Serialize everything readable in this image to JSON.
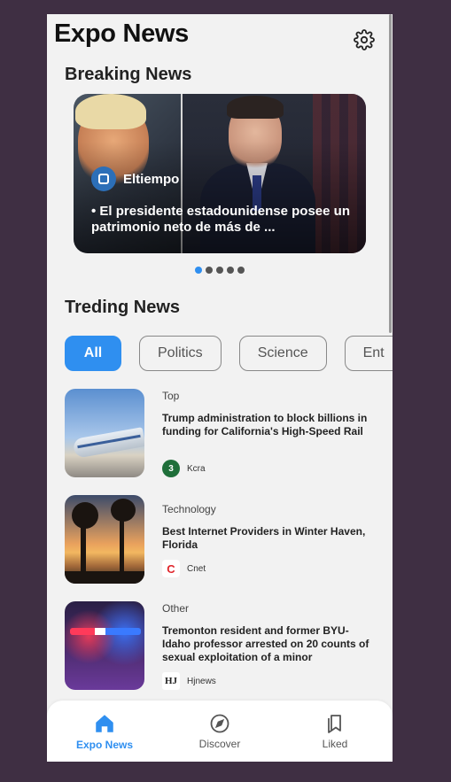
{
  "app": {
    "title": "Expo News"
  },
  "breaking": {
    "section_title": "Breaking News",
    "source": "Eltiempo",
    "headline": "• El presidente estadounidense posee un patrimonio neto de más de ...",
    "page_count": 5,
    "active_index": 0
  },
  "trending": {
    "section_title": "Treding News",
    "filters": [
      "All",
      "Politics",
      "Science",
      "Ent"
    ],
    "active_filter": "All"
  },
  "news": [
    {
      "category": "Top",
      "title": "Trump administration to block billions in funding for California's High-Speed Rail",
      "source": "Kcra",
      "thumb": "train"
    },
    {
      "category": "Technology",
      "title": "Best Internet Providers in Winter Haven, Florida",
      "source": "Cnet",
      "thumb": "sunset"
    },
    {
      "category": "Other",
      "title": "Tremonton resident and former BYU-Idaho professor arrested on 20 counts of sexual exploitation of a minor",
      "source": "Hjnews",
      "thumb": "police"
    }
  ],
  "nav": {
    "items": [
      {
        "label": "Expo News",
        "icon": "home-icon",
        "active": true
      },
      {
        "label": "Discover",
        "icon": "compass-icon",
        "active": false
      },
      {
        "label": "Liked",
        "icon": "bookmark-icon",
        "active": false
      }
    ]
  },
  "colors": {
    "accent": "#2f8ff0",
    "background": "#f2f2f2",
    "frame": "#3f2f43"
  }
}
